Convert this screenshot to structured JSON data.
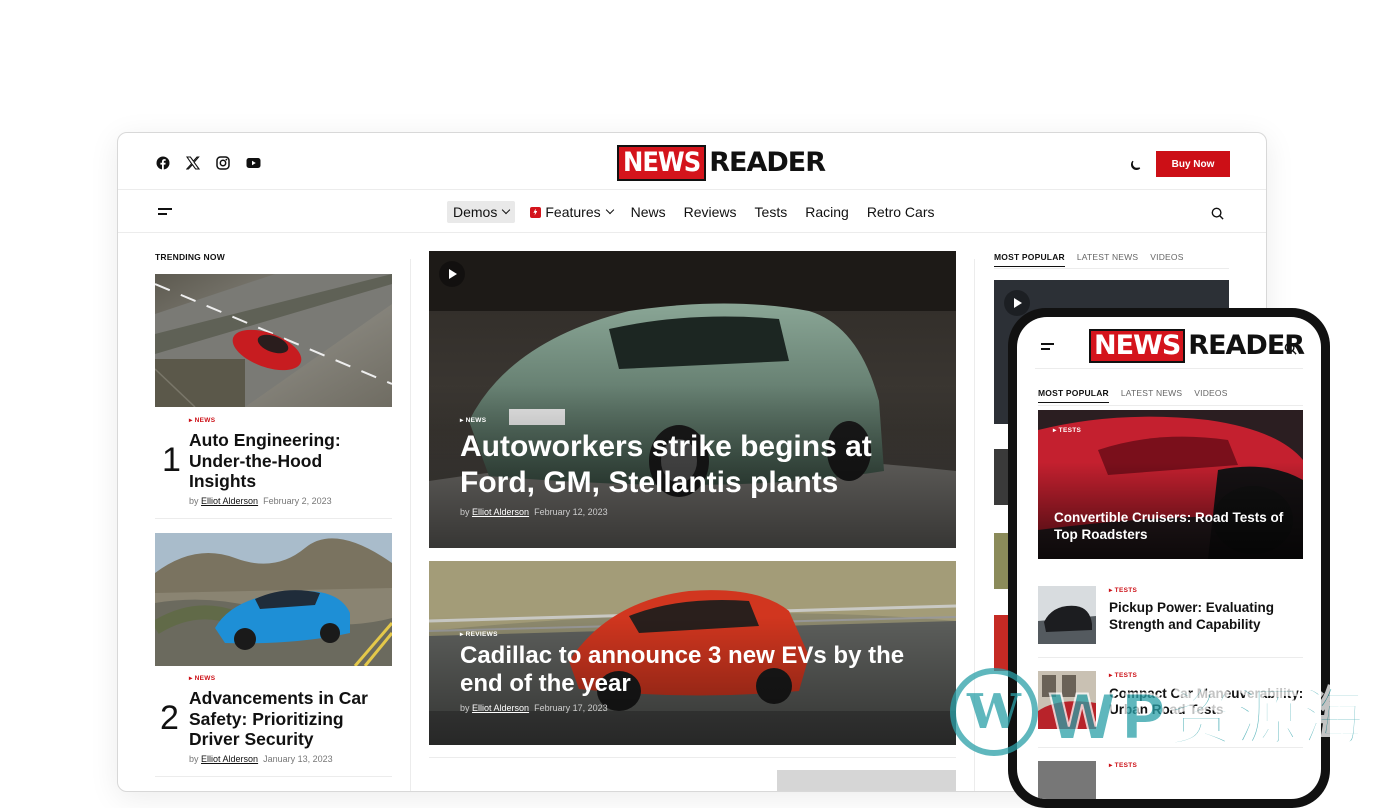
{
  "header": {
    "logo_news": "NEWS",
    "logo_reader": "READER",
    "buy_label": "Buy Now",
    "social": [
      "facebook-icon",
      "x-icon",
      "instagram-icon",
      "youtube-icon"
    ]
  },
  "nav": {
    "items": [
      "Demos",
      "Features",
      "News",
      "Reviews",
      "Tests",
      "Racing",
      "Retro Cars"
    ]
  },
  "left": {
    "section_label": "TRENDING NOW",
    "items": [
      {
        "num": "1",
        "category": "▸ NEWS",
        "title": "Auto Engineering: Under-the-Hood Insights",
        "by": "by",
        "author": "Elliot Alderson",
        "date": "February 2, 2023"
      },
      {
        "num": "2",
        "category": "▸ NEWS",
        "title": "Advancements in Car Safety: Prioritizing Driver Security",
        "by": "by",
        "author": "Elliot Alderson",
        "date": "January 13, 2023"
      }
    ]
  },
  "center": {
    "featured": [
      {
        "category": "▸ NEWS",
        "title": "Autoworkers strike begins at Ford, GM, Stellantis plants",
        "by": "by",
        "author": "Elliot Alderson",
        "date": "February 12, 2023"
      },
      {
        "category": "▸ REVIEWS",
        "title": "Cadillac to announce 3 new EVs by the end of the year",
        "by": "by",
        "author": "Elliot Alderson",
        "date": "February 17, 2023"
      }
    ]
  },
  "right": {
    "tabs": [
      "MOST POPULAR",
      "LATEST NEWS",
      "VIDEOS"
    ]
  },
  "phone": {
    "logo_news": "NEWS",
    "logo_reader": "READER",
    "tabs": [
      "MOST POPULAR",
      "LATEST NEWS",
      "VIDEOS"
    ],
    "hero": {
      "category": "▸ TESTS",
      "title": "Convertible Cruisers: Road Tests of Top Roadsters"
    },
    "items": [
      {
        "category": "▸ TESTS",
        "title": "Pickup Power: Evaluating Strength and Capability"
      },
      {
        "category": "▸ TESTS",
        "title": "Compact Car Maneuverability: Urban Road Tests"
      },
      {
        "category": "▸ TESTS",
        "title": ""
      }
    ]
  },
  "watermark": {
    "text": "WP资源海"
  },
  "colors": {
    "accent": "#cc0f16",
    "text": "#111111",
    "muted": "#777777"
  }
}
